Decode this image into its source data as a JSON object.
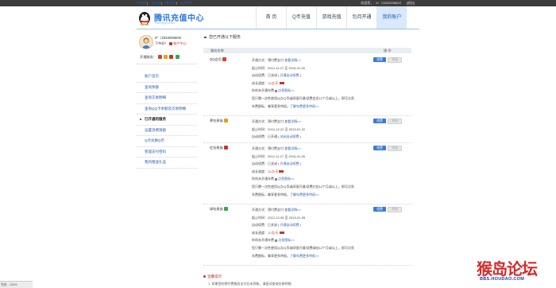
{
  "topbar": {
    "left_links": [
      "手机版",
      "论坛版",
      "腾讯网",
      "QQ空间"
    ],
    "right_text": "欢迎您，",
    "right_user": "d^（2633008609）",
    "right_logout": "[退出]"
  },
  "logo": {
    "title": "腾讯充值中心",
    "subtitle": "PAY.QQ.COM"
  },
  "nav": [
    {
      "label": "首 页"
    },
    {
      "label": "Q币充值"
    },
    {
      "label": "游戏充值"
    },
    {
      "label": "包月开通"
    },
    {
      "label": "我的账户",
      "active": true
    }
  ],
  "user": {
    "name": "d^（2633008609）",
    "greeting": "下午好！",
    "account_center": "账户中心",
    "services_label": "开通服务："
  },
  "menu": [
    {
      "label": "账户首页"
    },
    {
      "label": "查询余额"
    },
    {
      "label": "查询交易明细"
    },
    {
      "label": "查询QQ卡余额及交易明细"
    },
    {
      "label": "已开通的服务",
      "current": true
    },
    {
      "label": "设置消费限额"
    },
    {
      "label": "Q点兑换Q币"
    },
    {
      "label": "管理支付密码"
    },
    {
      "label": "我的赠送礼品"
    }
  ],
  "main": {
    "section_title": "您已开通以下服务",
    "col_name": "服务名称",
    "col_action": "操 作",
    "services": [
      {
        "name": "QQ会员",
        "icon_color": "#d5432a",
        "lines": [
          {
            "text": "开通方式：预付费支付  ",
            "link": "查看详情>>"
          },
          {
            "text": "起止时间：2012-11-27 至 2013-01-26"
          },
          {
            "text": "自动续费：已关闭 ( ",
            "link": "开通自动续费",
            "after": " )"
          },
          {
            "text": "成长速度：",
            "hl": "10点/天",
            "tag": true
          },
          {
            "text": "你尚未开通年费 ",
            "link": "点亮图标>>"
          },
          {
            "text": "您只需一次性使用Q点/Q币或网银开通/续费会员12个月或以上，即可点亮"
          },
          {
            "text": "年费图标，尊享更多特权。",
            "link": "了解年费更多特权>>"
          }
        ],
        "buttons": [
          "续费",
          "关闭"
        ]
      },
      {
        "name": "黄钻贵族",
        "icon_color": "#e0a21b",
        "lines": [
          {
            "text": "开通方式：预付费支付  ",
            "link": "查看详情>>"
          },
          {
            "text": "起止时间：2012-12-22 至 2013-01-22"
          },
          {
            "text": "自动续费：已开通 ( ",
            "link": "关闭自动续费",
            "after": " )"
          }
        ],
        "buttons": [
          "续费",
          "关闭"
        ]
      },
      {
        "name": "红钻贵族",
        "icon_color": "#c0392b",
        "lines": [
          {
            "text": "开通方式：预付费支付  ",
            "link": "查看详情>>"
          },
          {
            "text": "起止时间：2012-11-27 至 2013-01-26"
          },
          {
            "text": "自动续费：已关闭 ( ",
            "link": "开通自动续费",
            "after": " )"
          },
          {
            "text": "成长速度：",
            "hl": "11点/天",
            "tag": true
          },
          {
            "text": "你尚未开通年费 ",
            "link": "点亮图标>>"
          },
          {
            "text": "您只需一次性使用Q点/Q币或网银开通/续费红钻12个月或以上，即可点亮"
          },
          {
            "text": "年费图标，尊享更多特权。",
            "link": "了解年费更多特权>>"
          }
        ],
        "buttons": [
          "续费",
          "关闭"
        ]
      },
      {
        "name": "绿钻贵族",
        "icon_color": "#3aa64a",
        "lines": [
          {
            "text": "开通方式：预付费支付  ",
            "link": "查看详情>>"
          },
          {
            "text": "起止时间：2012-12-05 至 2013-01-05"
          },
          {
            "text": "自动续费：已关闭 ( ",
            "link": "开通自动续费",
            "after": " )"
          },
          {
            "text": "成长速度：",
            "hl": "12点/天",
            "tag": true
          },
          {
            "text": "你尚未开通年费 ",
            "link": "点亮图标>>"
          },
          {
            "text": "您只需一次性使用Q点/Q币或网银开通/续费绿钻12个月或以上，即可点亮"
          },
          {
            "text": "年费图标，尊享更多特权。",
            "link": "了解年费更多特权>>"
          }
        ],
        "buttons": [
          "续费",
          "关闭"
        ]
      }
    ],
    "tips_title": "温馨提示",
    "tips_line": "1. 如果您的预付费服务支付后未到账，请尝试查询交易明细"
  },
  "statusbar": "完成 - 100%",
  "watermark": {
    "big": "猴岛论坛",
    "url": "BBS.HOUDAO.COM"
  }
}
